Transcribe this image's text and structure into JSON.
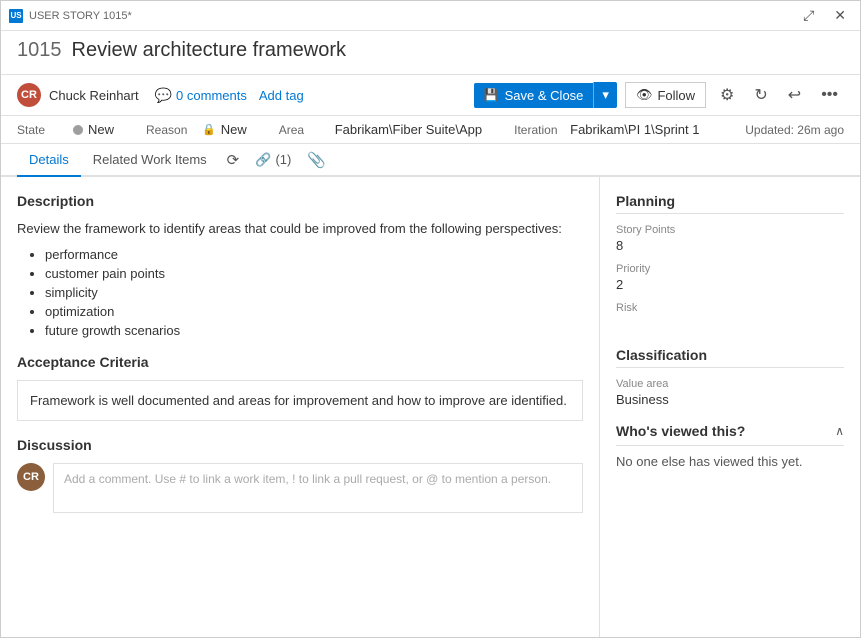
{
  "titleBar": {
    "label": "USER STORY 1015*",
    "expandBtn": "⤢",
    "closeBtn": "✕"
  },
  "workItem": {
    "number": "1015",
    "title": "Review architecture framework"
  },
  "toolbar": {
    "avatarInitials": "CR",
    "authorName": "Chuck Reinhart",
    "commentsCount": "0 comments",
    "addTagLabel": "Add tag",
    "saveCloseLabel": "Save & Close",
    "followLabel": "Follow",
    "gearIcon": "⚙",
    "refreshIcon": "↻",
    "undoIcon": "↩",
    "moreIcon": "•••"
  },
  "meta": {
    "stateLabel": "State",
    "stateValue": "New",
    "reasonLabel": "Reason",
    "reasonValue": "New",
    "areaLabel": "Area",
    "areaValue": "Fabrikam\\Fiber Suite\\App",
    "iterationLabel": "Iteration",
    "iterationValue": "Fabrikam\\PI 1\\Sprint 1",
    "updatedText": "Updated: 26m ago"
  },
  "tabs": {
    "details": "Details",
    "relatedWorkItems": "Related Work Items",
    "historyIcon": "⟳",
    "linkCount": "(1)",
    "attachIcon": "📎"
  },
  "leftPanel": {
    "descriptionTitle": "Description",
    "descriptionText": "Review the framework to identify areas that could be improved from the following perspectives:",
    "bulletItems": [
      "performance",
      "customer pain points",
      "simplicity",
      "optimization",
      "future growth scenarios"
    ],
    "acceptanceCriteriaTitle": "Acceptance Criteria",
    "acceptanceText": "Framework is well documented and areas for improvement and how to improve are identified.",
    "discussionTitle": "Discussion",
    "commentPlaceholder": "Add a comment. Use # to link a work item, ! to link a pull request, or @ to mention a person.",
    "commentAvatarInitials": "CR"
  },
  "rightPanel": {
    "planningTitle": "Planning",
    "storyPointsLabel": "Story Points",
    "storyPointsValue": "8",
    "priorityLabel": "Priority",
    "priorityValue": "2",
    "riskLabel": "Risk",
    "riskValue": "",
    "classificationTitle": "Classification",
    "valueAreaLabel": "Value area",
    "valueAreaValue": "Business",
    "whosViewedTitle": "Who's viewed this?",
    "noViewsText": "No one else has viewed this yet."
  }
}
